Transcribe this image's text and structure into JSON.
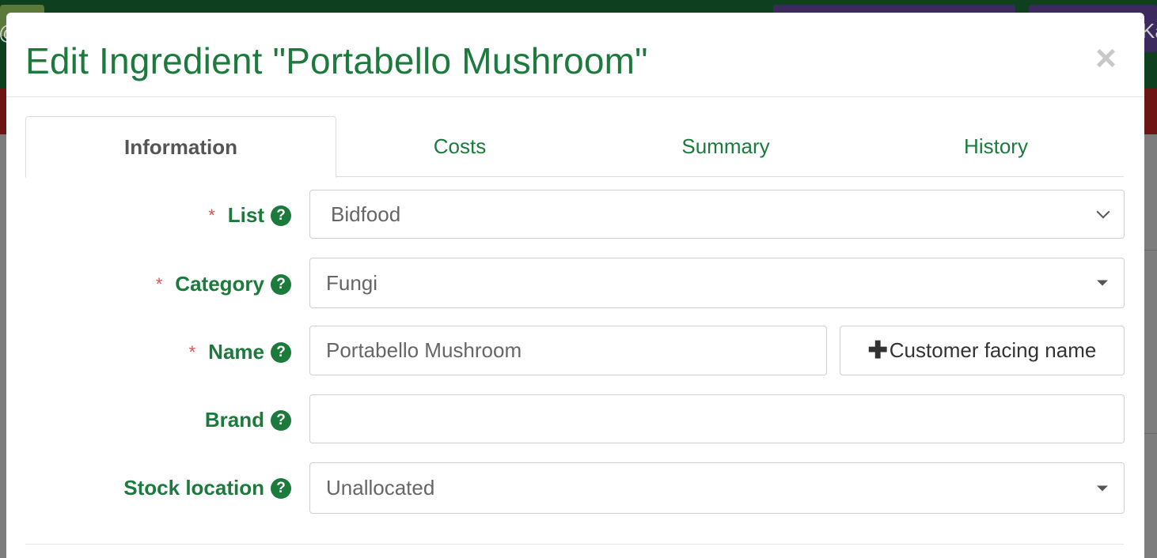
{
  "background": {
    "left_glyph": "@",
    "right_text": "Ka"
  },
  "modal": {
    "title": "Edit Ingredient \"Portabello Mushroom\"",
    "close_label": "×"
  },
  "tabs": [
    {
      "label": "Information",
      "active": true
    },
    {
      "label": "Costs",
      "active": false
    },
    {
      "label": "Summary",
      "active": false
    },
    {
      "label": "History",
      "active": false
    }
  ],
  "form": {
    "required_marker": "*",
    "help_glyph": "?",
    "list": {
      "label": "List",
      "value": "Bidfood",
      "required": true
    },
    "category": {
      "label": "Category",
      "value": "Fungi",
      "required": true
    },
    "name": {
      "label": "Name",
      "value": "Portabello Mushroom",
      "required": true
    },
    "customer_facing_button": {
      "icon": "plus-icon",
      "label": "Customer facing name"
    },
    "brand": {
      "label": "Brand",
      "value": "",
      "required": false
    },
    "stock_location": {
      "label": "Stock location",
      "value": "Unallocated",
      "required": false
    }
  },
  "colors": {
    "brand_green": "#1c7a3d",
    "required_red": "#d9534f"
  }
}
